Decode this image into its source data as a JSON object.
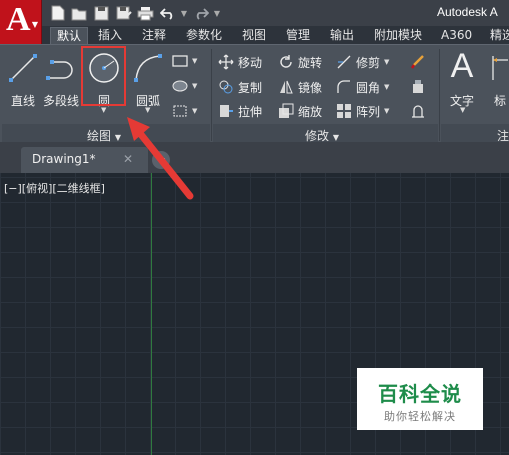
{
  "window": {
    "title": "Autodesk A"
  },
  "app_menu": {
    "logo": "A",
    "caret": "▼"
  },
  "quick_access": {
    "icons": [
      "new-icon",
      "open-icon",
      "save-icon",
      "save-as-icon",
      "print-icon",
      "undo-icon",
      "redo-icon"
    ]
  },
  "ribbon_tabs": [
    {
      "label": "默认",
      "active": true
    },
    {
      "label": "插入"
    },
    {
      "label": "注释"
    },
    {
      "label": "参数化"
    },
    {
      "label": "视图"
    },
    {
      "label": "管理"
    },
    {
      "label": "输出"
    },
    {
      "label": "附加模块"
    },
    {
      "label": "A360"
    },
    {
      "label": "精选"
    }
  ],
  "draw_panel": {
    "title": "绘图",
    "line": "直线",
    "polyline": "多段线",
    "circle": "圆",
    "arc": "圆弧"
  },
  "modify_panel": {
    "title": "修改",
    "move": "移动",
    "rotate": "旋转",
    "trim": "修剪",
    "copy": "复制",
    "mirror": "镜像",
    "fillet": "圆角",
    "stretch": "拉伸",
    "scale": "缩放",
    "array": "阵列"
  },
  "annotation_panel": {
    "title": "注",
    "text_glyph": "A",
    "text": "文字",
    "dimension": "标"
  },
  "file_tab": {
    "name": "Drawing1*",
    "close": "✕",
    "add": "+"
  },
  "viewport": {
    "label": "[−][俯视][二维线框]"
  },
  "watermark": {
    "title": "百科全说",
    "subtitle": "助你轻松解决"
  },
  "colors": {
    "app_red": "#c0121b",
    "ribbon": "#4b525b",
    "canvas": "#212830",
    "highlight": "#e53a35",
    "watermark_green": "#1e8c4a"
  }
}
